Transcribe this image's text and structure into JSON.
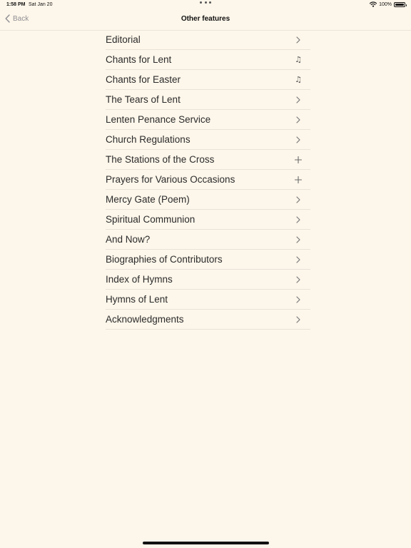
{
  "status_bar": {
    "time": "1:58 PM",
    "date": "Sat Jan 20",
    "battery": "100%"
  },
  "nav": {
    "back_label": "Back",
    "title": "Other features"
  },
  "items": [
    {
      "label": "Editorial",
      "icon": "chevron-right-icon"
    },
    {
      "label": "Chants for Lent",
      "icon": "music-note-icon"
    },
    {
      "label": "Chants for Easter",
      "icon": "music-note-icon"
    },
    {
      "label": "The Tears of Lent",
      "icon": "chevron-right-icon"
    },
    {
      "label": "Lenten Penance Service",
      "icon": "chevron-right-icon"
    },
    {
      "label": "Church Regulations",
      "icon": "chevron-right-icon"
    },
    {
      "label": "The Stations of the Cross",
      "icon": "plus-icon"
    },
    {
      "label": "Prayers for Various Occasions",
      "icon": "plus-icon"
    },
    {
      "label": "Mercy Gate (Poem)",
      "icon": "chevron-right-icon"
    },
    {
      "label": "Spiritual Communion",
      "icon": "chevron-right-icon"
    },
    {
      "label": "And Now?",
      "icon": "chevron-right-icon"
    },
    {
      "label": "Biographies of Contributors",
      "icon": "chevron-right-icon"
    },
    {
      "label": "Index of Hymns",
      "icon": "chevron-right-icon"
    },
    {
      "label": "Hymns of Lent",
      "icon": "chevron-right-icon"
    },
    {
      "label": "Acknowledgments",
      "icon": "chevron-right-icon"
    }
  ],
  "colors": {
    "background": "#fdf6ea",
    "separator": "#e8e2d8",
    "secondary_text": "#8e8e93"
  }
}
